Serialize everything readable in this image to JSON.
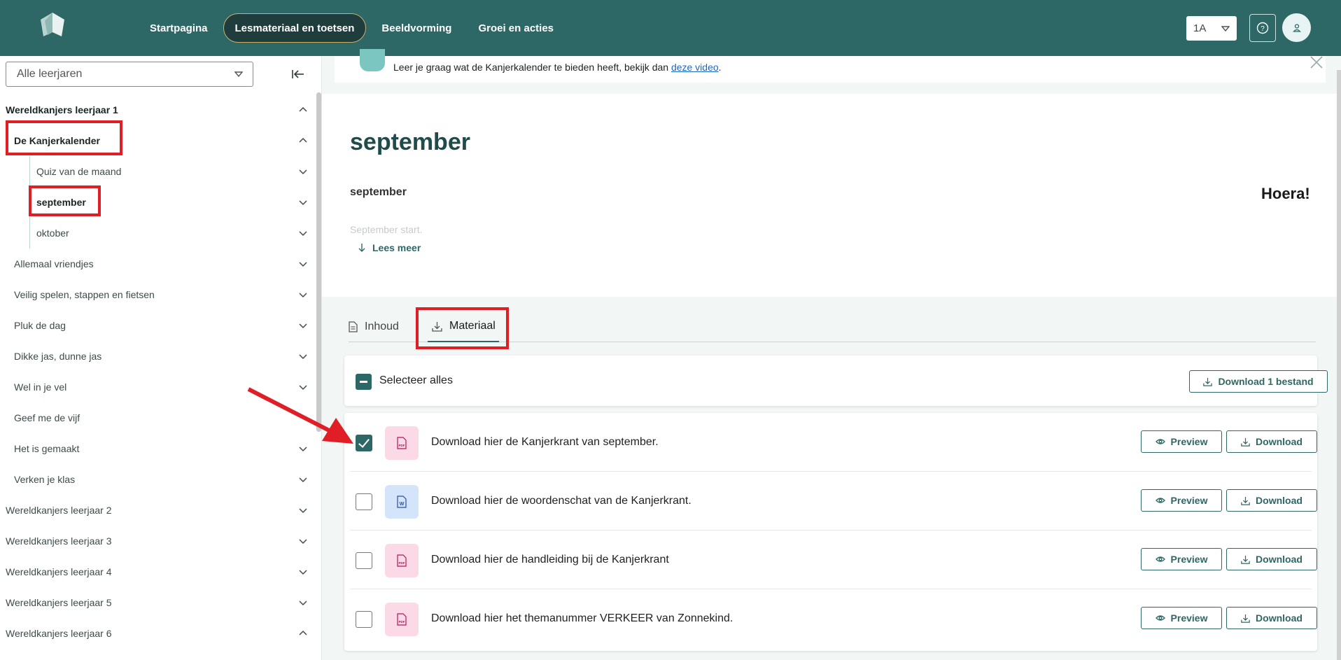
{
  "nav": {
    "items": [
      {
        "label": "Startpagina",
        "active": false
      },
      {
        "label": "Lesmateriaal en toetsen",
        "active": true
      },
      {
        "label": "Beeldvorming",
        "active": false
      },
      {
        "label": "Groei en acties",
        "active": false
      }
    ],
    "class_select": "1A"
  },
  "sidebar": {
    "year_select": "Alle leerjaren",
    "tree": [
      {
        "label": "Wereldkanjers leerjaar 1",
        "level": 0,
        "bold": true,
        "chevron": "up"
      },
      {
        "label": "De Kanjerkalender",
        "level": 1,
        "bold": true,
        "chevron": "up",
        "highlighted": true
      },
      {
        "label": "Quiz van de maand",
        "level": 2,
        "bold": false,
        "chevron": "down"
      },
      {
        "label": "september",
        "level": 2,
        "bold": true,
        "chevron": "down",
        "highlighted": true
      },
      {
        "label": "oktober",
        "level": 2,
        "bold": false,
        "chevron": "down"
      },
      {
        "label": "Allemaal vriendjes",
        "level": 1,
        "bold": false,
        "chevron": "down"
      },
      {
        "label": "Veilig spelen, stappen en fietsen",
        "level": 1,
        "bold": false,
        "chevron": "down"
      },
      {
        "label": "Pluk de dag",
        "level": 1,
        "bold": false,
        "chevron": "down"
      },
      {
        "label": "Dikke jas, dunne jas",
        "level": 1,
        "bold": false,
        "chevron": "down"
      },
      {
        "label": "Wel in je vel",
        "level": 1,
        "bold": false,
        "chevron": "down"
      },
      {
        "label": "Geef me de vijf",
        "level": 1,
        "bold": false,
        "chevron": ""
      },
      {
        "label": "Het is gemaakt",
        "level": 1,
        "bold": false,
        "chevron": "down"
      },
      {
        "label": "Verken je klas",
        "level": 1,
        "bold": false,
        "chevron": "down"
      },
      {
        "label": "Wereldkanjers leerjaar 2",
        "level": 0,
        "bold": false,
        "chevron": "down"
      },
      {
        "label": "Wereldkanjers leerjaar 3",
        "level": 0,
        "bold": false,
        "chevron": "down"
      },
      {
        "label": "Wereldkanjers leerjaar 4",
        "level": 0,
        "bold": false,
        "chevron": "down"
      },
      {
        "label": "Wereldkanjers leerjaar 5",
        "level": 0,
        "bold": false,
        "chevron": "down"
      },
      {
        "label": "Wereldkanjers leerjaar 6",
        "level": 0,
        "bold": false,
        "chevron": "up"
      }
    ]
  },
  "banner": {
    "text": "Leer je graag wat de Kanjerkalender te bieden heeft, bekijk dan ",
    "link": "deze video",
    "suffix": "."
  },
  "header": {
    "title": "september",
    "subtitle": "september",
    "hoera": "Hoera!",
    "faded_text": "September start.",
    "read_more": "Lees meer"
  },
  "tabs": [
    {
      "label": "Inhoud",
      "active": false
    },
    {
      "label": "Materiaal",
      "active": true
    }
  ],
  "select_all": {
    "label": "Selecteer alles",
    "download_label": "Download 1 bestand"
  },
  "files": [
    {
      "name": "Download hier de Kanjerkrant van september.",
      "type": "pdf",
      "checked": true
    },
    {
      "name": "Download hier de woordenschat van de Kanjerkrant.",
      "type": "word",
      "checked": false
    },
    {
      "name": "Download hier de handleiding bij de Kanjerkrant",
      "type": "pdf",
      "checked": false
    },
    {
      "name": "Download hier het themanummer VERKEER van Zonnekind.",
      "type": "pdf",
      "checked": false
    }
  ],
  "buttons": {
    "preview": "Preview",
    "download": "Download"
  },
  "colors": {
    "brand": "#2d6766",
    "highlight": "#e01e25"
  }
}
